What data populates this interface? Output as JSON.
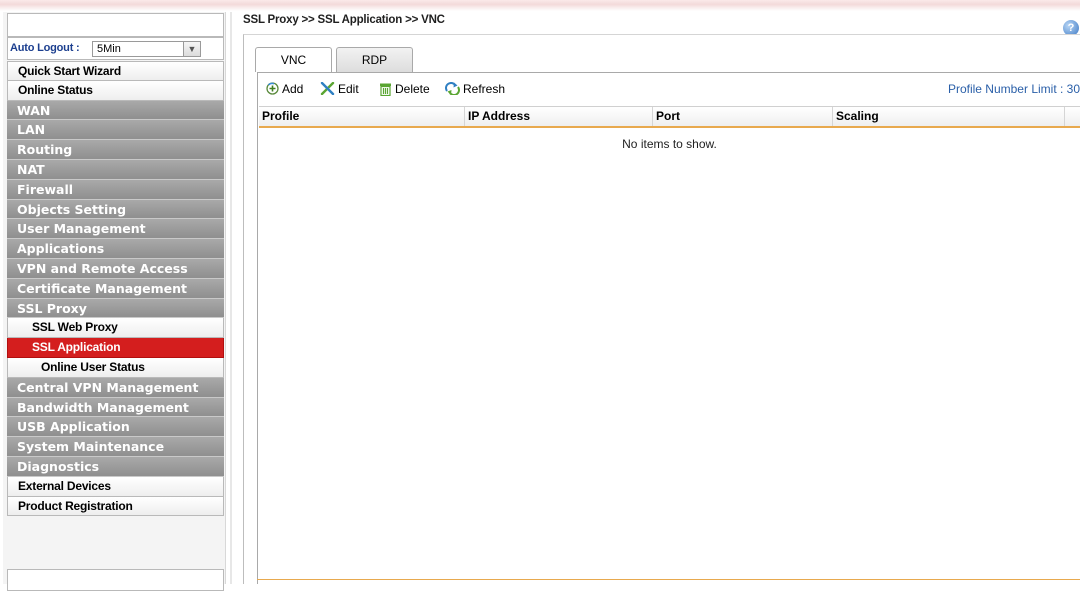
{
  "breadcrumb": "SSL Proxy >> SSL Application >> VNC",
  "help_icon": "help-icon",
  "sidebar": {
    "auto_logout_label": "Auto Logout :",
    "auto_logout_value": "5Min",
    "menu": [
      {
        "label": "Quick Start Wizard",
        "style": "white"
      },
      {
        "label": "Online Status",
        "style": "white"
      },
      {
        "label": "WAN",
        "style": "gray"
      },
      {
        "label": "LAN",
        "style": "gray"
      },
      {
        "label": "Routing",
        "style": "gray"
      },
      {
        "label": "NAT",
        "style": "gray"
      },
      {
        "label": "Firewall",
        "style": "gray"
      },
      {
        "label": "Objects Setting",
        "style": "gray"
      },
      {
        "label": "User Management",
        "style": "gray"
      },
      {
        "label": "Applications",
        "style": "gray"
      },
      {
        "label": "VPN and Remote Access",
        "style": "gray"
      },
      {
        "label": "Certificate Management",
        "style": "gray"
      },
      {
        "label": "SSL Proxy",
        "style": "gray"
      },
      {
        "label": "SSL Web Proxy",
        "style": "sub"
      },
      {
        "label": "SSL Application",
        "style": "active"
      },
      {
        "label": "Online User Status",
        "style": "sub"
      },
      {
        "label": "Central VPN Management",
        "style": "gray"
      },
      {
        "label": "Bandwidth Management",
        "style": "gray"
      },
      {
        "label": "USB Application",
        "style": "gray"
      },
      {
        "label": "System Maintenance",
        "style": "gray"
      },
      {
        "label": "Diagnostics",
        "style": "gray"
      },
      {
        "label": "External Devices",
        "style": "white"
      },
      {
        "label": "Product Registration",
        "style": "white"
      }
    ]
  },
  "tabs": [
    {
      "label": "VNC",
      "active": true
    },
    {
      "label": "RDP",
      "active": false
    }
  ],
  "toolbar": {
    "add": "Add",
    "edit": "Edit",
    "delete": "Delete",
    "refresh": "Refresh",
    "profile_limit": "Profile Number Limit : 30"
  },
  "grid": {
    "columns": [
      "Profile",
      "IP Address",
      "Port",
      "Scaling"
    ],
    "empty_text": "No items to show."
  },
  "colors": {
    "active_menu": "#d41e1e",
    "gray_menu": "#9c9c9c",
    "header_underline": "#e8a94e",
    "link_blue": "#2a5fa8"
  }
}
